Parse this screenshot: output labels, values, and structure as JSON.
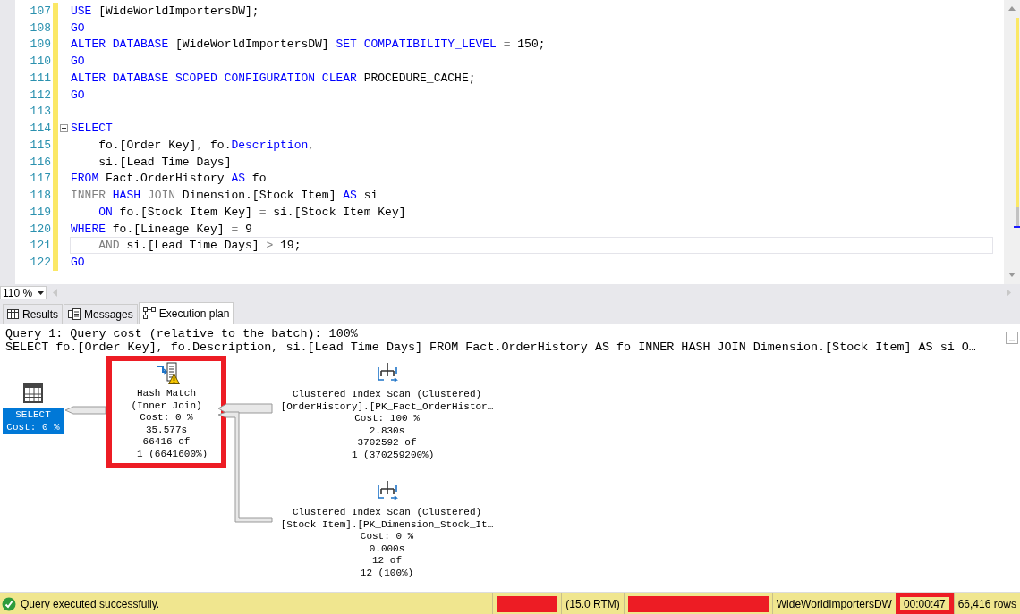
{
  "editor": {
    "lines": [
      {
        "number": "107",
        "current": false,
        "fold_start": false,
        "tokens": [
          {
            "kind": "keyword",
            "t": "USE"
          },
          {
            "kind": "plain",
            "t": " [WideWorldImportersDW];"
          }
        ]
      },
      {
        "number": "108",
        "current": false,
        "fold_start": false,
        "tokens": [
          {
            "kind": "keyword",
            "t": "GO"
          }
        ]
      },
      {
        "number": "109",
        "current": false,
        "fold_start": false,
        "tokens": [
          {
            "kind": "keyword",
            "t": "ALTER DATABASE"
          },
          {
            "kind": "plain",
            "t": " [WideWorldImportersDW] "
          },
          {
            "kind": "keyword",
            "t": "SET COMPATIBILITY_LEVEL"
          },
          {
            "kind": "operator",
            "t": " = "
          },
          {
            "kind": "plain",
            "t": "150;"
          }
        ]
      },
      {
        "number": "110",
        "current": false,
        "fold_start": false,
        "tokens": [
          {
            "kind": "keyword",
            "t": "GO"
          }
        ]
      },
      {
        "number": "111",
        "current": false,
        "fold_start": false,
        "tokens": [
          {
            "kind": "keyword",
            "t": "ALTER DATABASE SCOPED CONFIGURATION CLEAR"
          },
          {
            "kind": "plain",
            "t": " PROCEDURE_CACHE;"
          }
        ]
      },
      {
        "number": "112",
        "current": false,
        "fold_start": false,
        "tokens": [
          {
            "kind": "keyword",
            "t": "GO"
          }
        ]
      },
      {
        "number": "113",
        "current": false,
        "fold_start": false
      },
      {
        "number": "114",
        "current": false,
        "fold_start": true,
        "tokens": [
          {
            "kind": "keyword",
            "t": "SELECT"
          }
        ]
      },
      {
        "number": "115",
        "current": false,
        "fold_start": false,
        "tokens": [
          {
            "kind": "plain",
            "t": "    fo.[Order Key]"
          },
          {
            "kind": "operator",
            "t": ","
          },
          {
            "kind": "plain",
            "t": " fo."
          },
          {
            "kind": "keyword",
            "t": "Description"
          },
          {
            "kind": "operator",
            "t": ","
          }
        ]
      },
      {
        "number": "116",
        "current": false,
        "fold_start": false,
        "tokens": [
          {
            "kind": "plain",
            "t": "    si.[Lead Time Days]"
          }
        ]
      },
      {
        "number": "117",
        "current": false,
        "fold_start": false,
        "tokens": [
          {
            "kind": "keyword",
            "t": "FROM"
          },
          {
            "kind": "plain",
            "t": " Fact.OrderHistory "
          },
          {
            "kind": "keyword",
            "t": "AS"
          },
          {
            "kind": "plain",
            "t": " fo"
          }
        ]
      },
      {
        "number": "118",
        "current": false,
        "fold_start": false,
        "tokens": [
          {
            "kind": "operator",
            "t": "INNER "
          },
          {
            "kind": "keyword",
            "t": "HASH "
          },
          {
            "kind": "operator",
            "t": "JOIN"
          },
          {
            "kind": "plain",
            "t": " Dimension.[Stock Item] "
          },
          {
            "kind": "keyword",
            "t": "AS"
          },
          {
            "kind": "plain",
            "t": " si"
          }
        ]
      },
      {
        "number": "119",
        "current": false,
        "fold_start": false,
        "tokens": [
          {
            "kind": "keyword",
            "t": "    ON"
          },
          {
            "kind": "plain",
            "t": " fo.[Stock Item Key] "
          },
          {
            "kind": "operator",
            "t": "="
          },
          {
            "kind": "plain",
            "t": " si.[Stock Item Key]"
          }
        ]
      },
      {
        "number": "120",
        "current": false,
        "fold_start": false,
        "tokens": [
          {
            "kind": "keyword",
            "t": "WHERE"
          },
          {
            "kind": "plain",
            "t": " fo.[Lineage Key] "
          },
          {
            "kind": "operator",
            "t": "="
          },
          {
            "kind": "plain",
            "t": " 9"
          }
        ]
      },
      {
        "number": "121",
        "current": true,
        "fold_start": false,
        "tokens": [
          {
            "kind": "operator",
            "t": "    AND"
          },
          {
            "kind": "plain",
            "t": " si.[Lead Time Days] "
          },
          {
            "kind": "operator",
            "t": ">"
          },
          {
            "kind": "plain",
            "t": " 19;"
          }
        ]
      },
      {
        "number": "122",
        "current": false,
        "fold_start": false,
        "tokens": [
          {
            "kind": "keyword",
            "t": "GO"
          }
        ]
      }
    ]
  },
  "zoom": {
    "value": "110 %"
  },
  "tabs": [
    {
      "label": "Results",
      "selected": false
    },
    {
      "label": "Messages",
      "selected": false
    },
    {
      "label": "Execution plan",
      "selected": true
    }
  ],
  "plan": {
    "header_lines": [
      "Query 1: Query cost (relative to the batch): 100%",
      "SELECT fo.[Order Key], fo.Description, si.[Lead Time Days] FROM Fact.OrderHistory AS fo INNER HASH JOIN Dimension.[Stock Item] AS si O…"
    ],
    "nodes": [
      {
        "kind": "select",
        "selected": true,
        "highlighted": false,
        "warning": false,
        "lines": [
          "SELECT",
          "Cost: 0 %"
        ]
      },
      {
        "kind": "hash",
        "selected": false,
        "highlighted": true,
        "warning": true,
        "lines": [
          "Hash Match",
          "(Inner Join)",
          "Cost: 0 %",
          "35.577s",
          "66416 of",
          "  1 (6641600%)"
        ]
      },
      {
        "kind": "scan",
        "selected": false,
        "highlighted": false,
        "warning": false,
        "lines": [
          "Clustered Index Scan (Clustered)",
          "[OrderHistory].[PK_Fact_OrderHistor…",
          "Cost: 100 %",
          "2.830s",
          "3702592 of",
          "  1 (370259200%)"
        ]
      },
      {
        "kind": "scan",
        "selected": false,
        "highlighted": false,
        "warning": false,
        "lines": [
          "Clustered Index Scan (Clustered)",
          "[Stock Item].[PK_Dimension_Stock_It…",
          "Cost: 0 %",
          "0.000s",
          "12 of",
          "12 (100%)"
        ]
      }
    ]
  },
  "status_bar": {
    "message": "Query executed successfully.",
    "items": [
      {
        "kind": "redacted",
        "highlighted": false
      },
      {
        "kind": "text",
        "text": "(15.0 RTM)",
        "highlighted": false
      },
      {
        "kind": "redacted",
        "highlighted": false
      },
      {
        "kind": "text",
        "text": "WideWorldImportersDW",
        "highlighted": false
      },
      {
        "kind": "text",
        "text": "00:00:47",
        "highlighted": true
      },
      {
        "kind": "text",
        "text": "66,416 rows",
        "highlighted": false
      }
    ]
  }
}
